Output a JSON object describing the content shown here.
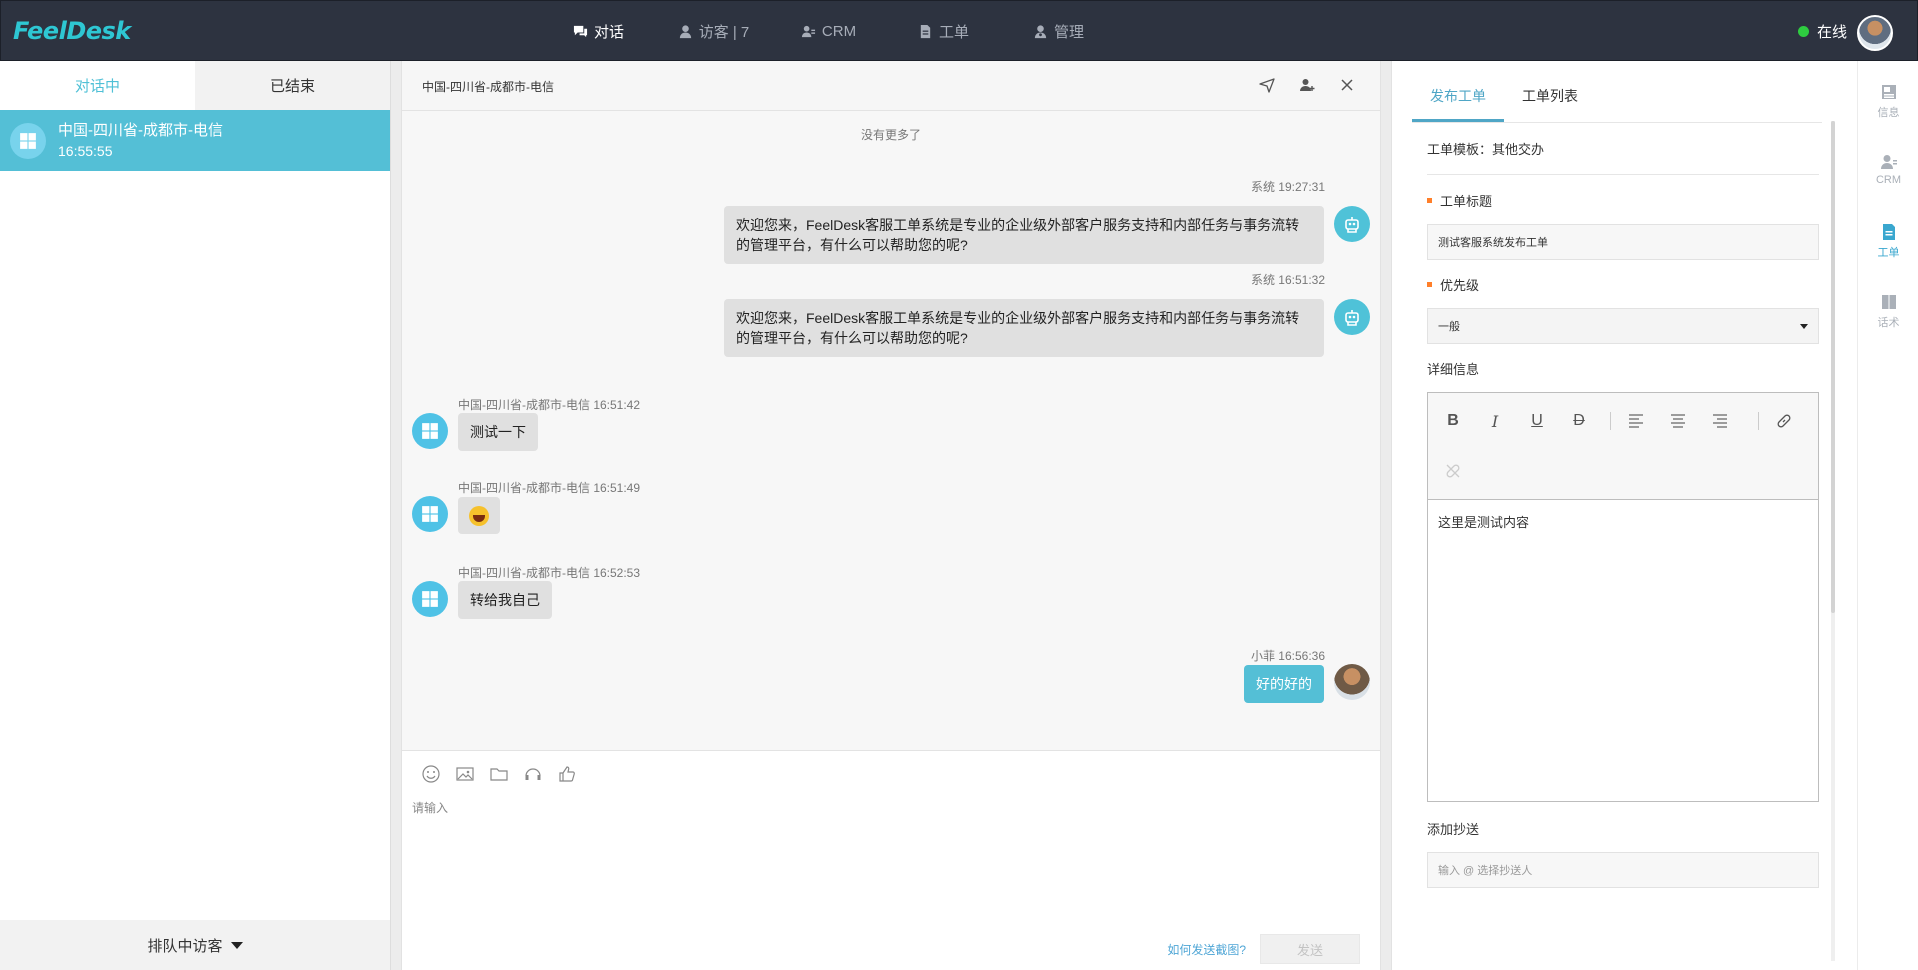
{
  "app": {
    "logo": "FeelDesk"
  },
  "nav": [
    {
      "label": "对话",
      "icon": "chat-icon"
    },
    {
      "label": "访客 | 7",
      "icon": "visitor-icon"
    },
    {
      "label": "CRM",
      "icon": "crm-icon"
    },
    {
      "label": "工单",
      "icon": "ticket-icon"
    },
    {
      "label": "管理",
      "icon": "admin-icon"
    }
  ],
  "status": {
    "label": "在线",
    "color": "#2ecc40"
  },
  "left": {
    "tabs": [
      "对话中",
      "已结束"
    ],
    "sessions": [
      {
        "title": "中国-四川省-成都市-电信",
        "time": "16:55:55"
      }
    ],
    "queue_label": "排队中访客"
  },
  "chat": {
    "title": "中国-四川省-成都市-电信",
    "no_more": "没有更多了",
    "messages": [
      {
        "meta": "系统 19:27:31",
        "text_line1": "欢迎您来，FeelDesk客服工单系统是专业的企业级外部客户服务支持和内部任务与事务流转",
        "text_line2": "的管理平台，有什么可以帮助您的呢?"
      },
      {
        "meta": "系统 16:51:32",
        "text_line1": "欢迎您来，FeelDesk客服工单系统是专业的企业级外部客户服务支持和内部任务与事务流转",
        "text_line2": "的管理平台，有什么可以帮助您的呢?"
      },
      {
        "meta": "中国-四川省-成都市-电信 16:51:42",
        "text": "测试一下"
      },
      {
        "meta": "中国-四川省-成都市-电信 16:51:49",
        "text": ""
      },
      {
        "meta": "中国-四川省-成都市-电信 16:52:53",
        "text": "转给我自己"
      },
      {
        "meta": "小菲 16:56:36",
        "text": "好的好的"
      }
    ],
    "input_placeholder": "请输入",
    "howto": "如何发送截图?",
    "send": "发送"
  },
  "ticket": {
    "tabs": [
      "发布工单",
      "工单列表"
    ],
    "template": "工单模板：其他交办",
    "title_label": "工单标题",
    "title_value": "测试客服系统发布工单",
    "priority_label": "优先级",
    "priority_value": "一般",
    "detail_label": "详细信息",
    "detail_value": "这里是测试内容",
    "cc_label": "添加抄送",
    "cc_placeholder": "输入 @ 选择抄送人"
  },
  "rail": [
    {
      "label": "信息",
      "icon": "info-icon"
    },
    {
      "label": "CRM",
      "icon": "crm-icon"
    },
    {
      "label": "工单",
      "icon": "ticket-icon"
    },
    {
      "label": "话术",
      "icon": "script-icon"
    }
  ]
}
